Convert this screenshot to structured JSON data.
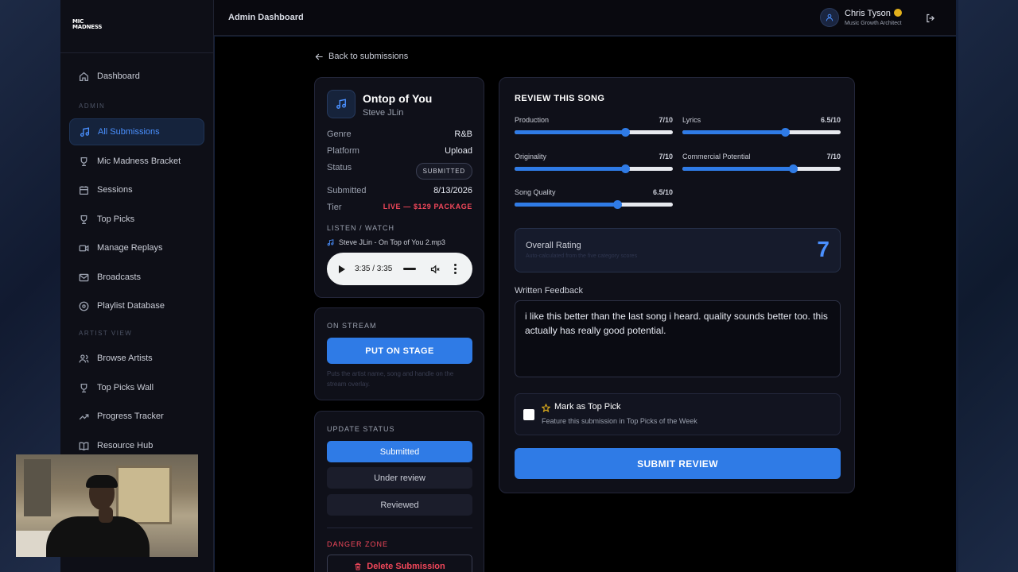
{
  "app": {
    "logo_text_line1": "MIC",
    "logo_text_line2": "MADNESS",
    "page_title": "Admin Dashboard"
  },
  "user": {
    "name": "Chris Tyson",
    "role": "Music Growth Architect"
  },
  "sidebar": {
    "dashboard": "Dashboard",
    "admin_section": "ADMIN",
    "admin_items": [
      "All Submissions",
      "Mic Madness Bracket",
      "Sessions",
      "Top Picks",
      "Manage Replays",
      "Broadcasts",
      "Playlist Database"
    ],
    "artist_section": "ARTIST VIEW",
    "artist_items": [
      "Browse Artists",
      "Top Picks Wall",
      "Progress Tracker",
      "Resource Hub"
    ]
  },
  "back_link": "Back to submissions",
  "song": {
    "title": "Ontop of You",
    "artist": "Steve JLin",
    "fields": [
      {
        "label": "Genre",
        "value": "R&B"
      },
      {
        "label": "Platform",
        "value": "Upload"
      },
      {
        "label": "Status",
        "value": "SUBMITTED"
      },
      {
        "label": "Submitted",
        "value": "8/13/2026"
      },
      {
        "label": "Tier",
        "value": "LIVE — $129 PACKAGE"
      }
    ],
    "listen_label": "LISTEN / WATCH",
    "file_name": "Steve JLin - On Top of You 2.mp3",
    "player_time": "3:35 / 3:35"
  },
  "stream": {
    "label": "ON STREAM",
    "button": "PUT ON STAGE",
    "help": "Puts the artist name, song and handle on the stream overlay."
  },
  "status_panel": {
    "label": "UPDATE STATUS",
    "options": [
      "Submitted",
      "Under review",
      "Reviewed"
    ],
    "active": "Submitted",
    "danger_label": "DANGER ZONE",
    "delete_button": "Delete Submission"
  },
  "review": {
    "title": "REVIEW THIS SONG",
    "scores": [
      {
        "label": "Production",
        "display": "7/10",
        "value": 7
      },
      {
        "label": "Lyrics",
        "display": "6.5/10",
        "value": 6.5
      },
      {
        "label": "Originality",
        "display": "7/10",
        "value": 7
      },
      {
        "label": "Commercial Potential",
        "display": "7/10",
        "value": 7
      },
      {
        "label": "Song Quality",
        "display": "6.5/10",
        "value": 6.5
      }
    ],
    "overall_label": "Overall Rating",
    "overall_sub": "Auto-calculated from the five category scores",
    "overall_value": "7",
    "feedback_label": "Written Feedback",
    "feedback_text": "i like this better than the last song i heard. quality sounds better too. this actually has really good potential.",
    "top_pick_title": "Mark as Top Pick",
    "top_pick_desc": "Feature this submission in Top Picks of the Week",
    "submit_button": "SUBMIT REVIEW"
  },
  "colors": {
    "accent": "#2f7be6",
    "danger": "#f2475a",
    "background": "#000000"
  }
}
